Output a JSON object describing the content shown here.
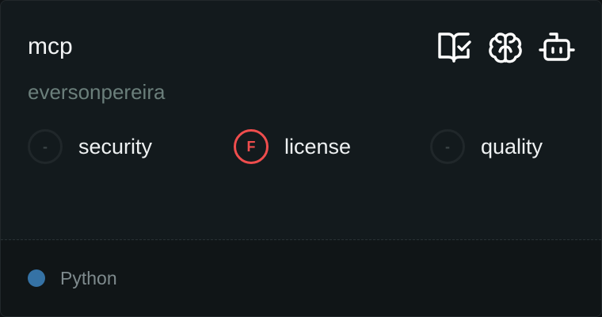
{
  "card": {
    "title": "mcp",
    "owner": "eversonpereira",
    "badges": [
      {
        "icon": "book-check-icon"
      },
      {
        "icon": "brain-icon"
      },
      {
        "icon": "bot-icon"
      }
    ],
    "scores": [
      {
        "name": "security",
        "grade": "-",
        "status": "none"
      },
      {
        "name": "license",
        "grade": "F",
        "status": "fail"
      },
      {
        "name": "quality",
        "grade": "-",
        "status": "none"
      }
    ],
    "language": {
      "name": "Python",
      "color": "#3572a5"
    }
  }
}
